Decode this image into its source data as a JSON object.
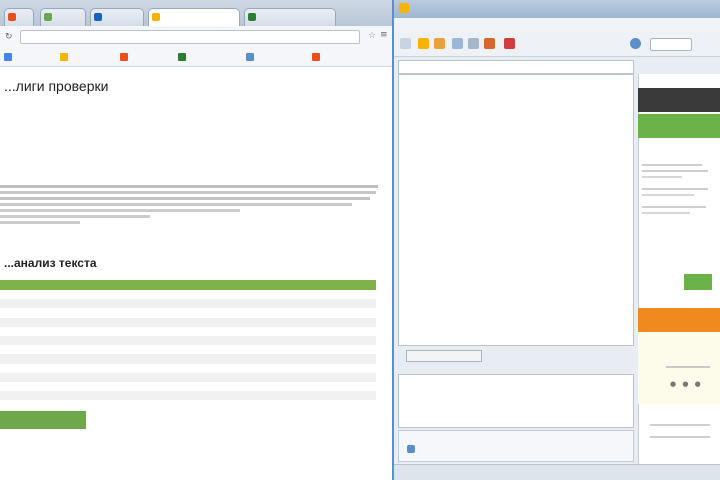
{
  "browser": {
    "tabs": [
      {
        "label": "",
        "color": "#e94f1d"
      },
      {
        "label": "",
        "color": "#6aa84f"
      },
      {
        "label": "",
        "color": "#1565c0"
      },
      {
        "label": "",
        "color": "#f4b400"
      },
      {
        "label": "",
        "color": "#2e7d32"
      }
    ],
    "url": "",
    "bookmarks": [
      {
        "label": "",
        "color": "#4285f4"
      },
      {
        "label": "",
        "color": "#f4b400"
      },
      {
        "label": "",
        "color": "#e94f1d"
      },
      {
        "label": "",
        "color": "#2e7d32"
      },
      {
        "label": "",
        "color": "#5b8fc9"
      },
      {
        "label": "",
        "color": "#e94f1d"
      }
    ],
    "page": {
      "title": "...лиги проверки",
      "meta1": "",
      "meta2": "",
      "section2_title": "...анализ текста",
      "table": {
        "header": [
          "",
          ""
        ],
        "rows": [
          [
            "",
            ""
          ],
          [
            "",
            ""
          ],
          [
            "",
            ""
          ],
          [
            "",
            ""
          ],
          [
            "",
            ""
          ],
          [
            "",
            ""
          ],
          [
            "",
            ""
          ],
          [
            "",
            ""
          ],
          [
            "",
            ""
          ],
          [
            "",
            ""
          ],
          [
            "",
            ""
          ],
          [
            "",
            ""
          ],
          [
            "",
            ""
          ]
        ]
      },
      "green_button": ""
    }
  },
  "app": {
    "title": "",
    "menu": [
      "",
      "",
      "",
      "",
      ""
    ],
    "search_placeholder": "",
    "editor_lines": [
      {
        "pre": "",
        "hl": "",
        "post": ""
      },
      {
        "pre": "",
        "hl": "",
        "post": ""
      },
      {
        "pre": "",
        "hl": "",
        "post": ""
      },
      {
        "pre": "",
        "hl": "",
        "post": ""
      },
      {
        "pre": "",
        "hl": "",
        "post": ""
      },
      {
        "pre": "",
        "hl": "",
        "post": ""
      },
      {
        "pre": "",
        "hl": "",
        "post": ""
      },
      {
        "pre": "",
        "hl": "",
        "post": ""
      },
      {
        "pre": "",
        "hl": "",
        "post": ""
      },
      {
        "pre": "",
        "hl": "",
        "post": ""
      },
      {
        "pre": "",
        "hl": "",
        "post": ""
      },
      {
        "pre": "",
        "hl": "",
        "post": ""
      },
      {
        "pre": "",
        "hl": "",
        "post": ""
      }
    ],
    "editor_button": "",
    "links": [
      "",
      "",
      "",
      "",
      ""
    ],
    "bottom_label": "",
    "status_left": "",
    "status_right": "",
    "side": {
      "dark_label": "",
      "green_label": "",
      "orange_label": "",
      "cream_value": ""
    },
    "colors": {
      "accent_green": "#6bb24a",
      "accent_orange": "#ee8a1e",
      "highlight": "#f6f21a"
    }
  }
}
